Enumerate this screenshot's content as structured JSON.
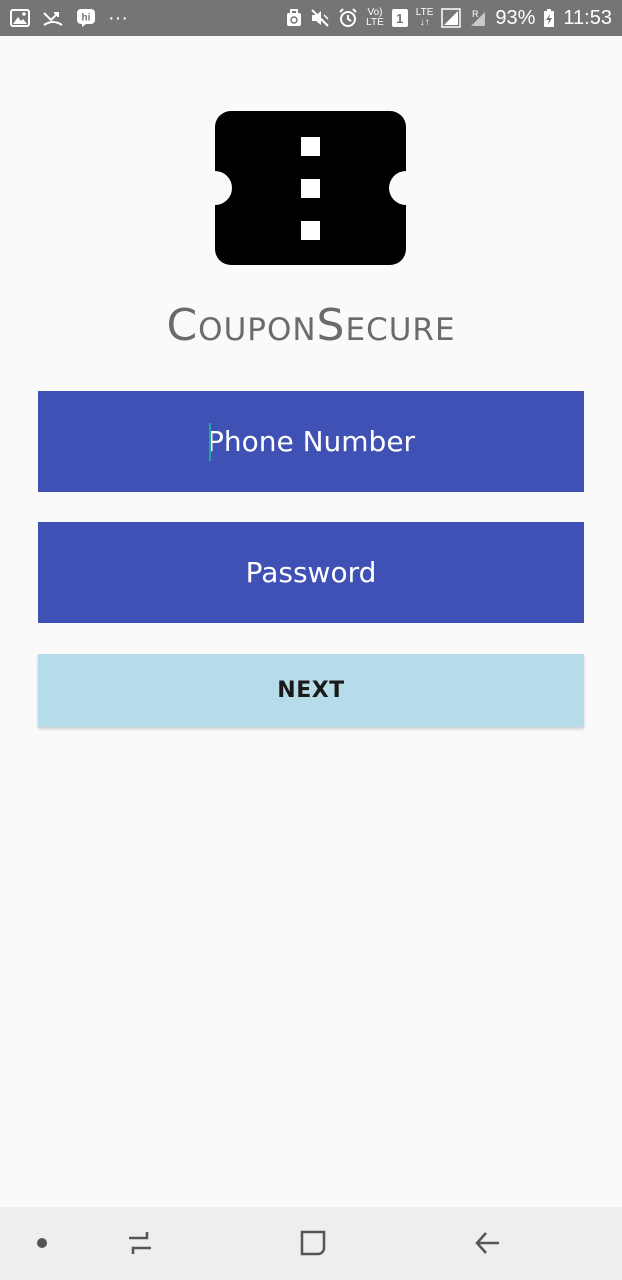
{
  "status_bar": {
    "battery": "93%",
    "time": "11:53",
    "volte_top": "Vo)",
    "volte_bottom": "LTE",
    "lte_label": "LTE",
    "sim_slot": "1",
    "notification_dots": "···",
    "icons": [
      "image-icon",
      "missed-call-icon",
      "hike-icon",
      "more-notifications-icon",
      "recycle-icon",
      "mute-icon",
      "alarm-icon",
      "volte-icon",
      "sim-1-icon",
      "lte-icon",
      "signal-icon",
      "signal-roaming-icon",
      "battery-charging-icon"
    ]
  },
  "app": {
    "title": "CouponSecure",
    "logo": "coupon-ticket-icon"
  },
  "form": {
    "phone_placeholder": "Phone Number",
    "password_placeholder": "Password",
    "next_label": "NEXT",
    "colors": {
      "field_background": "#3f51b5",
      "button_background": "#b6dcea",
      "caret": "#26a69a"
    }
  },
  "nav_bar": {
    "items": [
      "nav-dot-icon",
      "recent-apps-icon",
      "home-icon",
      "back-icon"
    ]
  }
}
